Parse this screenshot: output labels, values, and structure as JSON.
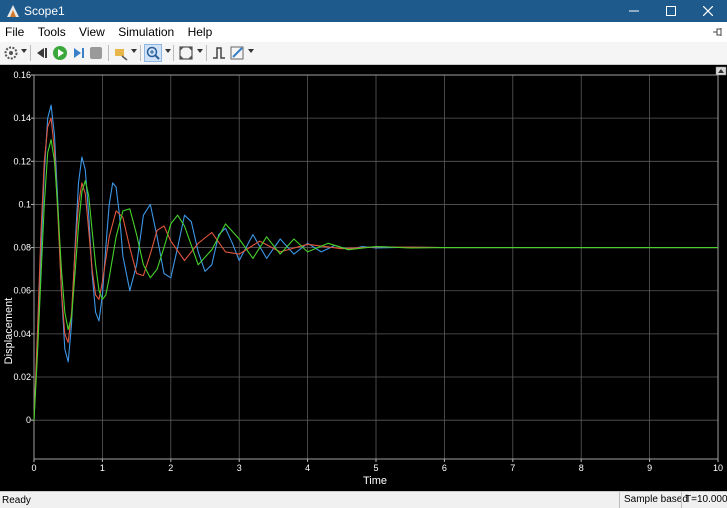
{
  "window": {
    "title": "Scope1",
    "icon": "matlab-scope-icon"
  },
  "menu": {
    "items": [
      "File",
      "Tools",
      "View",
      "Simulation",
      "Help"
    ],
    "pin_icon": "pin-icon"
  },
  "toolbar": {
    "icons": [
      "settings-icon",
      "step-back-icon",
      "run-icon",
      "step-forward-icon",
      "stop-icon",
      "highlight-icon",
      "zoom-in-icon",
      "fit-to-view-icon",
      "triggers-icon",
      "style-icon"
    ]
  },
  "status": {
    "ready": "Ready",
    "mode": "Sample based",
    "time": "T=10.000"
  },
  "colors": {
    "background": "#000000",
    "grid": "#5a5a5a",
    "series_blue": "#3c96e6",
    "series_red": "#e0553c",
    "series_green": "#46d22a"
  },
  "chart_data": {
    "type": "line",
    "xlabel": "Time",
    "ylabel": "Displacement",
    "xlim": [
      0,
      10
    ],
    "ylim": [
      -0.018,
      0.16
    ],
    "xticks": [
      "0",
      "1",
      "2",
      "3",
      "4",
      "5",
      "6",
      "7",
      "8",
      "9",
      "10"
    ],
    "yticks": [
      "0",
      "0.02",
      "0.04",
      "0.06",
      "0.08",
      "0.1",
      "0.12",
      "0.14",
      "0.16"
    ],
    "grid": true,
    "series": [
      {
        "color": "#3c96e6",
        "x": [
          0,
          0.05,
          0.1,
          0.15,
          0.2,
          0.25,
          0.3,
          0.35,
          0.4,
          0.45,
          0.5,
          0.55,
          0.6,
          0.65,
          0.7,
          0.75,
          0.8,
          0.85,
          0.9,
          0.95,
          1.0,
          1.05,
          1.1,
          1.15,
          1.2,
          1.25,
          1.3,
          1.4,
          1.5,
          1.6,
          1.7,
          1.8,
          1.9,
          2.0,
          2.1,
          2.2,
          2.3,
          2.4,
          2.5,
          2.6,
          2.7,
          2.8,
          2.9,
          3.0,
          3.2,
          3.4,
          3.6,
          3.8,
          4.0,
          4.2,
          4.4,
          4.6,
          4.8,
          5.0,
          5.5,
          6.0,
          7.0,
          8.0,
          9.0,
          10.0
        ],
        "y": [
          0,
          0.035,
          0.075,
          0.115,
          0.14,
          0.146,
          0.132,
          0.1,
          0.06,
          0.033,
          0.027,
          0.045,
          0.08,
          0.11,
          0.122,
          0.116,
          0.095,
          0.068,
          0.05,
          0.046,
          0.058,
          0.08,
          0.1,
          0.11,
          0.108,
          0.095,
          0.076,
          0.06,
          0.072,
          0.095,
          0.1,
          0.085,
          0.068,
          0.066,
          0.08,
          0.095,
          0.092,
          0.078,
          0.069,
          0.072,
          0.086,
          0.089,
          0.082,
          0.074,
          0.086,
          0.075,
          0.084,
          0.077,
          0.082,
          0.078,
          0.081,
          0.079,
          0.0805,
          0.0798,
          0.0802,
          0.08,
          0.08,
          0.08,
          0.08,
          0.08
        ]
      },
      {
        "color": "#e0553c",
        "x": [
          0,
          0.05,
          0.1,
          0.15,
          0.2,
          0.25,
          0.3,
          0.35,
          0.4,
          0.45,
          0.5,
          0.55,
          0.6,
          0.65,
          0.7,
          0.75,
          0.8,
          0.85,
          0.9,
          0.95,
          1.0,
          1.1,
          1.2,
          1.3,
          1.4,
          1.5,
          1.6,
          1.7,
          1.8,
          1.9,
          2.0,
          2.2,
          2.4,
          2.6,
          2.8,
          3.0,
          3.3,
          3.6,
          4.0,
          4.5,
          5.0,
          6.0,
          7.0,
          8.0,
          9.0,
          10.0
        ],
        "y": [
          0,
          0.04,
          0.085,
          0.12,
          0.136,
          0.14,
          0.125,
          0.095,
          0.06,
          0.04,
          0.036,
          0.05,
          0.078,
          0.1,
          0.11,
          0.105,
          0.088,
          0.07,
          0.058,
          0.056,
          0.064,
          0.085,
          0.097,
          0.094,
          0.08,
          0.068,
          0.067,
          0.077,
          0.088,
          0.09,
          0.083,
          0.074,
          0.082,
          0.087,
          0.078,
          0.077,
          0.083,
          0.078,
          0.0815,
          0.0795,
          0.0803,
          0.08,
          0.08,
          0.08,
          0.08,
          0.08
        ]
      },
      {
        "color": "#46d22a",
        "x": [
          0,
          0.05,
          0.1,
          0.15,
          0.2,
          0.25,
          0.3,
          0.35,
          0.4,
          0.45,
          0.5,
          0.55,
          0.6,
          0.65,
          0.7,
          0.75,
          0.8,
          0.85,
          0.9,
          0.95,
          1.0,
          1.05,
          1.1,
          1.2,
          1.3,
          1.4,
          1.5,
          1.6,
          1.7,
          1.8,
          1.9,
          2.0,
          2.1,
          2.2,
          2.4,
          2.6,
          2.8,
          3.0,
          3.2,
          3.4,
          3.6,
          3.8,
          4.0,
          4.3,
          4.6,
          5.0,
          5.5,
          6.0,
          7.0,
          8.0,
          9.0,
          10.0
        ],
        "y": [
          0,
          0.03,
          0.065,
          0.1,
          0.124,
          0.13,
          0.12,
          0.098,
          0.07,
          0.05,
          0.042,
          0.048,
          0.068,
          0.09,
          0.106,
          0.111,
          0.104,
          0.088,
          0.072,
          0.06,
          0.056,
          0.058,
          0.066,
          0.085,
          0.097,
          0.098,
          0.086,
          0.072,
          0.066,
          0.07,
          0.08,
          0.091,
          0.095,
          0.09,
          0.072,
          0.079,
          0.091,
          0.084,
          0.075,
          0.085,
          0.077,
          0.084,
          0.078,
          0.082,
          0.079,
          0.0805,
          0.0798,
          0.08,
          0.08,
          0.08,
          0.08,
          0.08
        ]
      }
    ]
  }
}
